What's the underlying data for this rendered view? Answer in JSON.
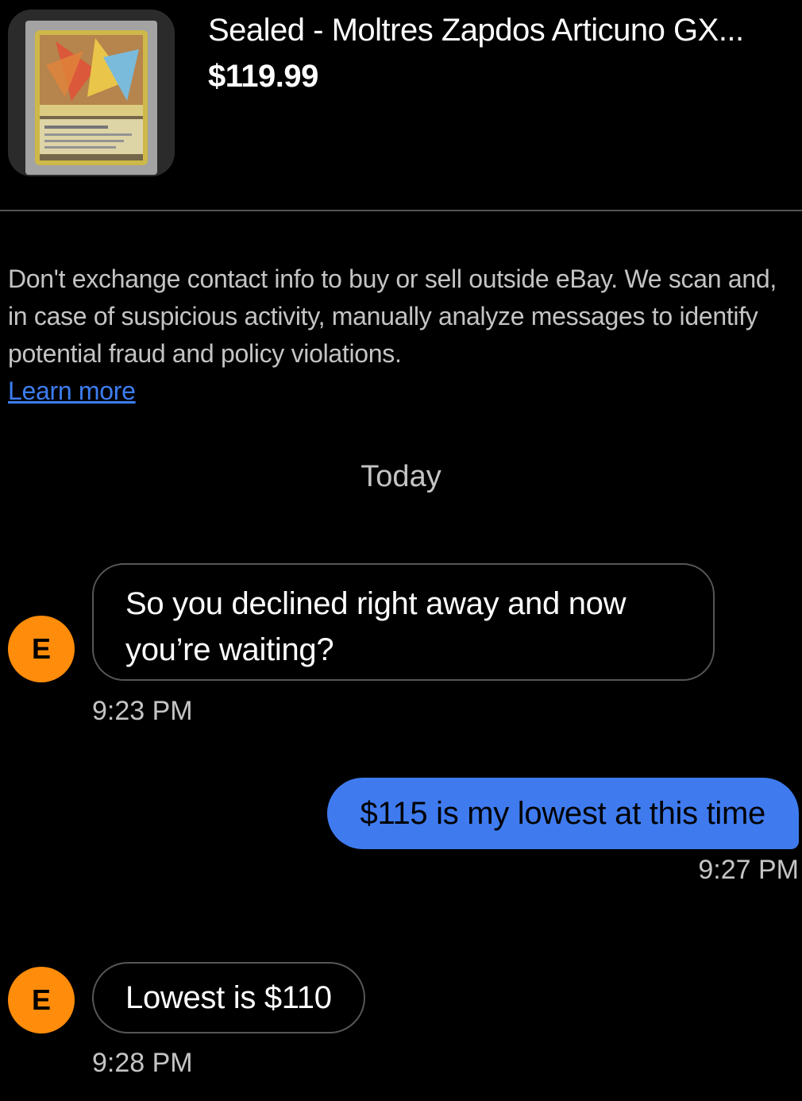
{
  "item": {
    "title": "Sealed - Moltres Zapdos Articuno GX...",
    "price": "$119.99",
    "image_icon": "pokemon-card-thumbnail"
  },
  "notice": {
    "text": "Don't exchange contact info to buy or sell outside eBay. We scan and, in case of suspicious activity, manually analyze messages to identify potential fraud and policy violations.",
    "link_label": "Learn more"
  },
  "day_label": "Today",
  "messages": [
    {
      "from": "other",
      "avatar_initial": "E",
      "text_line1": "So you declined right away and now",
      "text_line2": "you’re waiting?",
      "time": "9:23 PM"
    },
    {
      "from": "me",
      "text": "$115 is my lowest at this time",
      "time": "9:27 PM"
    },
    {
      "from": "other",
      "avatar_initial": "E",
      "text": "Lowest is $110",
      "time": "9:28 PM"
    }
  ],
  "colors": {
    "background": "#000000",
    "outgoing_bubble": "#3f7bef",
    "avatar": "#ff8c0a",
    "link": "#3d7df0"
  }
}
